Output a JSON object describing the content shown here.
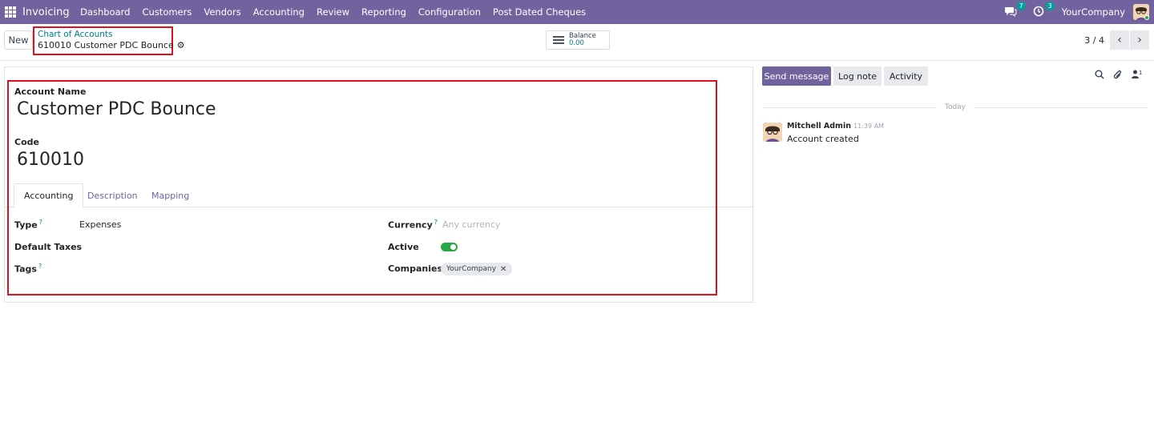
{
  "navbar": {
    "brand": "Invoicing",
    "menu": [
      "Dashboard",
      "Customers",
      "Vendors",
      "Accounting",
      "Review",
      "Reporting",
      "Configuration",
      "Post Dated Cheques"
    ],
    "messages_count": "7",
    "activities_count": "3",
    "company": "YourCompany"
  },
  "control_panel": {
    "new_label": "New",
    "breadcrumb_parent": "Chart of Accounts",
    "breadcrumb_current": "610010 Customer PDC Bounce",
    "balance_label": "Balance",
    "balance_value": "0.00",
    "pager": "3 / 4"
  },
  "form": {
    "account_name_label": "Account Name",
    "account_name": "Customer PDC Bounce",
    "code_label": "Code",
    "code": "610010",
    "tabs": [
      "Accounting",
      "Description",
      "Mapping"
    ],
    "type_label": "Type",
    "type_value": "Expenses",
    "default_taxes_label": "Default Taxes",
    "tags_label": "Tags",
    "currency_label": "Currency",
    "currency_placeholder": "Any currency",
    "active_label": "Active",
    "active": true,
    "companies_label": "Companies",
    "company_tag": "YourCompany",
    "help_mark": "?"
  },
  "chatter": {
    "send_message": "Send message",
    "log_note": "Log note",
    "activity": "Activity",
    "followers_count": "1",
    "date_separator": "Today",
    "message": {
      "author": "Mitchell Admin",
      "time": "11:39 AM",
      "body": "Account created"
    }
  }
}
